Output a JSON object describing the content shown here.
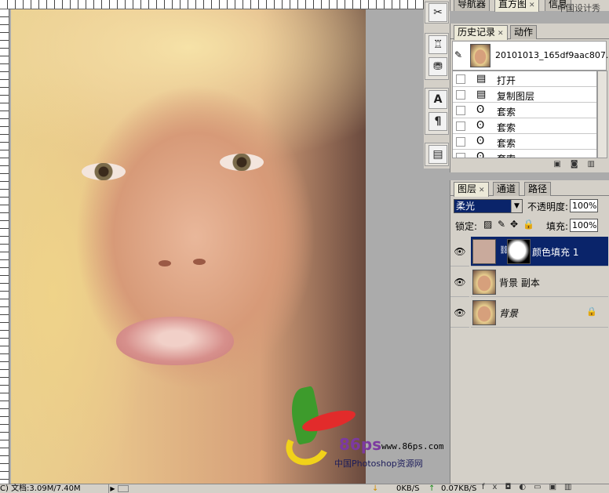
{
  "status": {
    "doc_info": "C) 文档:3.09M/7.40M",
    "download_speed": "0KB/S",
    "upload_speed": "0.07KB/S"
  },
  "watermark": {
    "number": "86ps",
    "url": "www.86ps.com",
    "caption": "中国Photoshop资源网",
    "corner": "中国设计秀"
  },
  "nav_panel": {
    "tabs": [
      "导航器",
      "直方图",
      "信息"
    ]
  },
  "history_panel": {
    "tabs": [
      "历史记录",
      "动作"
    ],
    "snapshot_name": "20101013_165df9aac807...",
    "items": [
      {
        "icon": "document-icon",
        "label": "打开"
      },
      {
        "icon": "document-icon",
        "label": "复制图层"
      },
      {
        "icon": "lasso-icon",
        "label": "套索"
      },
      {
        "icon": "lasso-icon",
        "label": "套索"
      },
      {
        "icon": "lasso-icon",
        "label": "套索"
      },
      {
        "icon": "lasso-icon",
        "label": "套索"
      }
    ]
  },
  "layers_panel": {
    "tabs": [
      "图层",
      "通道",
      "路径"
    ],
    "blend_mode": "柔光",
    "opacity_label": "不透明度:",
    "opacity_value": "100%",
    "lock_label": "锁定:",
    "fill_label": "填充:",
    "fill_value": "100%",
    "layers": [
      {
        "name": "颜色填充 1",
        "selected": true,
        "thumb_color": "#c9aa9c"
      },
      {
        "name": "背景 副本",
        "selected": false
      },
      {
        "name": "背景",
        "selected": false,
        "locked": true
      }
    ]
  },
  "tools": {
    "icons": [
      "tools-icon",
      "stamp-icon",
      "paint-bucket-icon",
      "type-icon",
      "paragraph-icon",
      "notes-icon"
    ],
    "glyphs": [
      "✂",
      "♖",
      "⛃",
      "A",
      "¶",
      "▤"
    ]
  }
}
